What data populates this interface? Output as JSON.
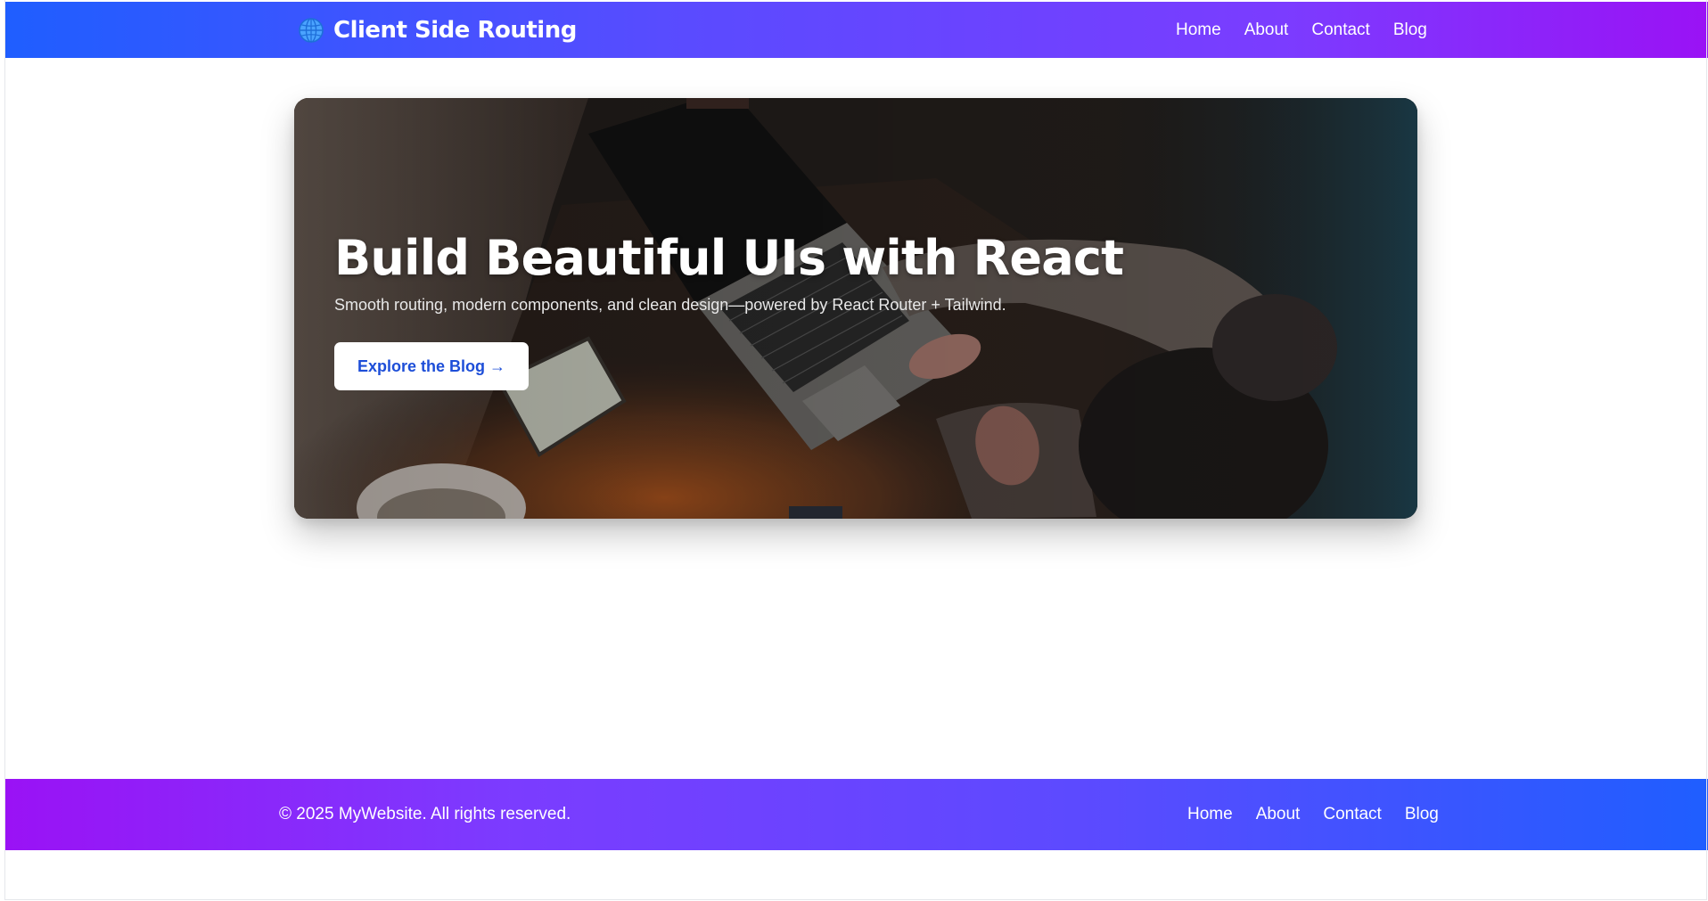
{
  "header": {
    "brand_title": "Client Side Routing",
    "brand_icon": "globe-icon",
    "nav": [
      {
        "label": "Home"
      },
      {
        "label": "About"
      },
      {
        "label": "Contact"
      },
      {
        "label": "Blog"
      }
    ]
  },
  "hero": {
    "title": "Build Beautiful UIs with React",
    "subtitle": "Smooth routing, modern components, and clean design—powered by React Router + Tailwind.",
    "cta_label": "Explore the Blog →"
  },
  "footer": {
    "copyright": "© 2025 MyWebsite. All rights reserved.",
    "nav": [
      {
        "label": "Home"
      },
      {
        "label": "About"
      },
      {
        "label": "Contact"
      },
      {
        "label": "Blog"
      }
    ]
  },
  "colors": {
    "gradient_blue": "#1f5eff",
    "gradient_purple": "#9a12f5",
    "cta_text": "#1d4ed8"
  }
}
